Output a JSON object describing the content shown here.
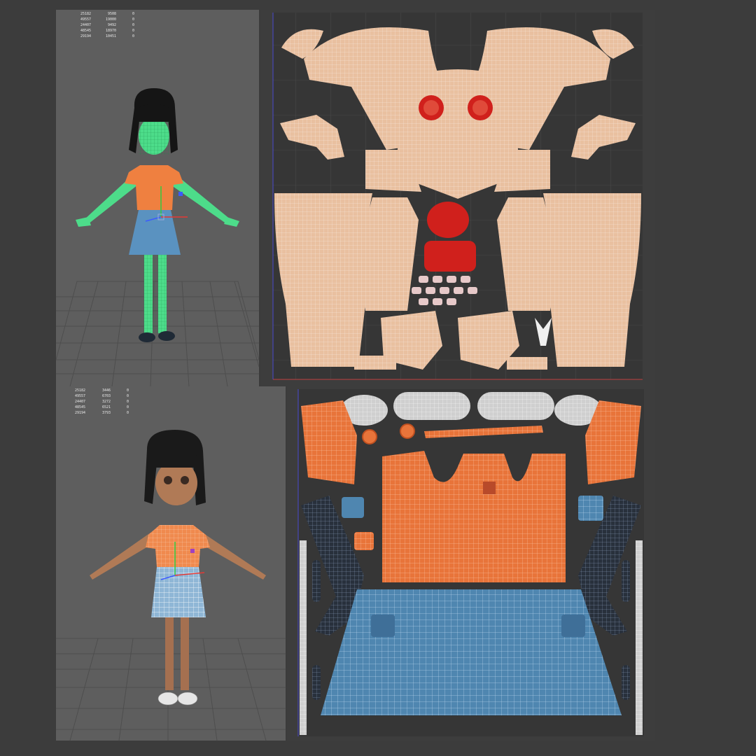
{
  "top_viewport": {
    "stats": [
      [
        "25182",
        "9508",
        "0"
      ],
      [
        "49557",
        "19000",
        "0"
      ],
      [
        "24407",
        "9492",
        "0"
      ],
      [
        "48545",
        "18970",
        "0"
      ],
      [
        "29194",
        "10451",
        "0"
      ]
    ]
  },
  "bottom_viewport": {
    "stats": [
      [
        "25182",
        "3446",
        "0"
      ],
      [
        "49557",
        "6703",
        "0"
      ],
      [
        "24407",
        "3272",
        "0"
      ],
      [
        "48545",
        "6521",
        "0"
      ],
      [
        "29194",
        "3793",
        "0"
      ]
    ]
  },
  "colors": {
    "background": "#3c3c3c",
    "viewport": "#5e5e5e",
    "uv_background": "#3d3d3d",
    "skin_uv": "#e9c0a0",
    "eye_red": "#d0201c",
    "shirt_orange": "#e8743a",
    "skirt_blue": "#4f86b0",
    "sock_dark": "#28303c",
    "shoe_grey": "#cfcfcf",
    "wireframe_green": "#4ddc8a"
  }
}
